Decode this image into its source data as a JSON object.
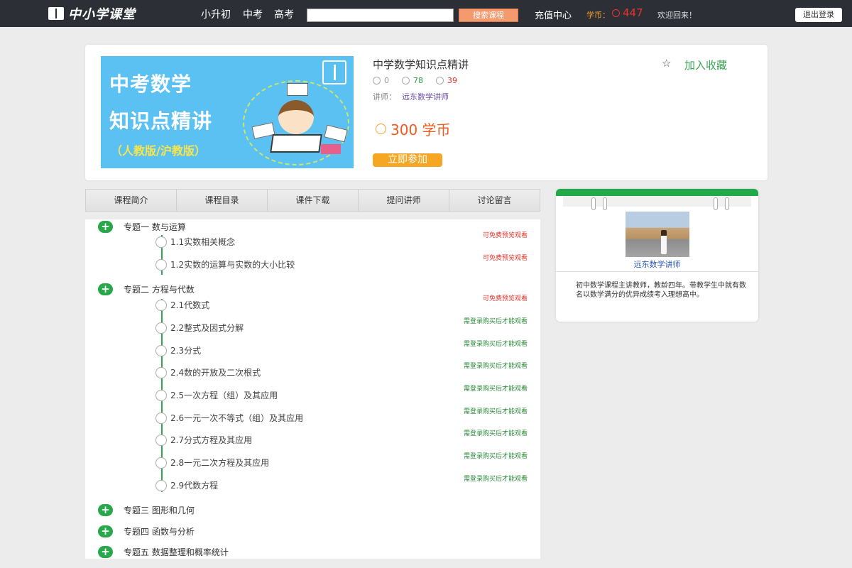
{
  "header": {
    "logo_text": "中小学课堂",
    "nav": [
      "小升初",
      "中考",
      "高考"
    ],
    "search_placeholder": "",
    "search_button": "搜索课程",
    "recharge": "充值中心",
    "coins_label": "学币：",
    "coins_value": "447",
    "welcome": "欢迎回来！",
    "logout": "退出登录"
  },
  "course": {
    "banner": {
      "line1": "中考数学",
      "line2": "知识点精讲",
      "sub": "（人教版/沪教版）"
    },
    "title": "中学数学知识点精讲",
    "favorite": "加入收藏",
    "stats": {
      "students": "0",
      "likes": "78",
      "dislikes": "39"
    },
    "teacher_label": "讲师：",
    "teacher_name": "远东数学讲师",
    "price": "300 学币",
    "join_button": "立即参加"
  },
  "tabs": [
    "课程简介",
    "课程目录",
    "课件下载",
    "提问讲师",
    "讨论留言"
  ],
  "catalog": {
    "topics": [
      {
        "label": "专题一  数与运算"
      },
      {
        "label": "专题二  方程与代数"
      },
      {
        "label": "专题三  图形和几何"
      },
      {
        "label": "专题四  函数与分析"
      },
      {
        "label": "专题五  数据整理和概率统计"
      }
    ],
    "lessons": [
      {
        "label": "1.1实数相关概念",
        "status": "可免费预览观看"
      },
      {
        "label": "1.2实数的运算与实数的大小比较",
        "status": "可免费预览观看"
      },
      {
        "label": "2.1代数式",
        "status": "可免费预览观看"
      },
      {
        "label": "2.2整式及因式分解",
        "status": "需登录购买后才能观看"
      },
      {
        "label": "2.3分式",
        "status": "需登录购买后才能观看"
      },
      {
        "label": "2.4数的开放及二次根式",
        "status": "需登录购买后才能观看"
      },
      {
        "label": "2.5一次方程（组）及其应用",
        "status": "需登录购买后才能观看"
      },
      {
        "label": "2.6一元一次不等式（组）及其应用",
        "status": "需登录购买后才能观看"
      },
      {
        "label": "2.7分式方程及其应用",
        "status": "需登录购买后才能观看"
      },
      {
        "label": "2.8一元二次方程及其应用",
        "status": "需登录购买后才能观看"
      },
      {
        "label": "2.9代数方程",
        "status": "需登录购买后才能观看"
      }
    ]
  },
  "teacher_card": {
    "name": "远东数学讲师",
    "description": "初中数学课程主讲教师，教龄四年。带教学生中就有数名以数学满分的优异成绩考入理想高中。"
  },
  "colors": {
    "topbar": "#2c2f36",
    "accent_green": "#28a84a",
    "price": "#f05a1e",
    "join": "#f5a623",
    "free": "#e8322c",
    "buy": "#2e8b3a"
  }
}
